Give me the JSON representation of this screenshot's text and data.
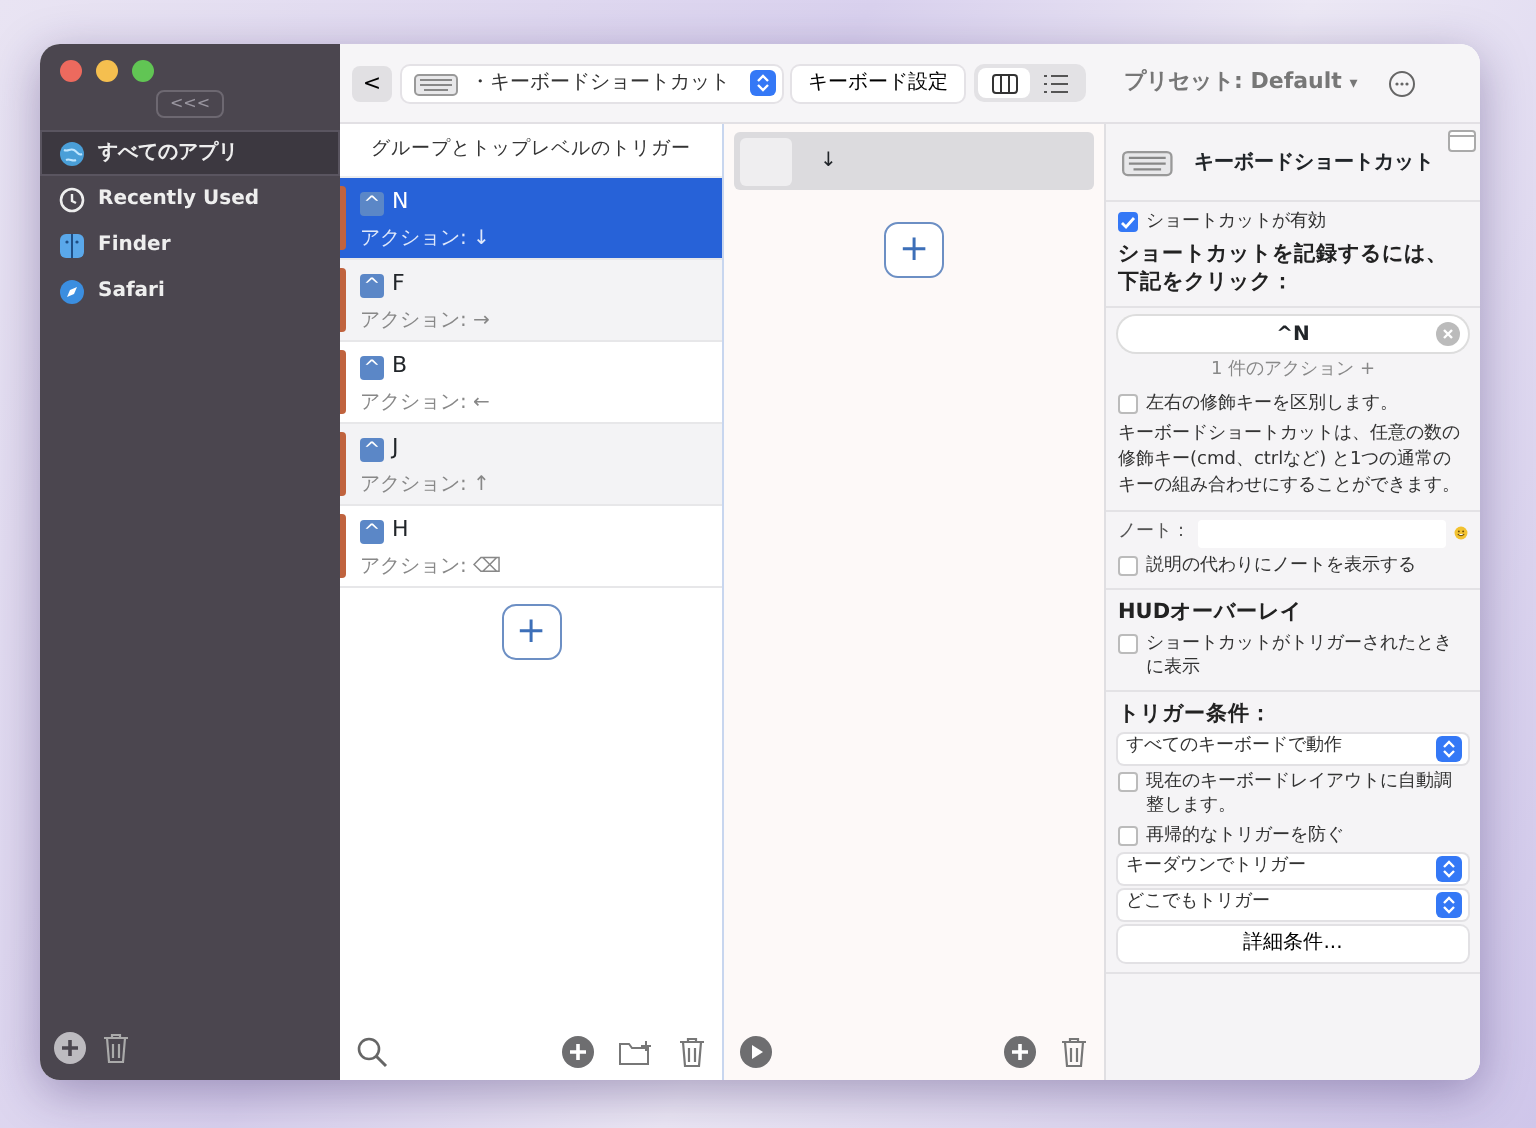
{
  "window": {
    "collapse_button": "<<<"
  },
  "sidebar": {
    "items": [
      {
        "label": "すべてのアプリ",
        "kind": "globe",
        "selected": true
      },
      {
        "label": "Recently Used",
        "kind": "clock",
        "selected": false
      },
      {
        "label": "Finder",
        "kind": "finder",
        "selected": false
      },
      {
        "label": "Safari",
        "kind": "compass",
        "selected": false
      }
    ]
  },
  "toolbar": {
    "back": "<",
    "trigger_type": "・キーボードショートカット",
    "settings_button": "キーボード設定",
    "views": [
      {
        "kind": "columns",
        "selected": true
      },
      {
        "kind": "list",
        "selected": false
      }
    ],
    "preset": "プリセット: Default",
    "preset_caret": "▾"
  },
  "triggers": {
    "header": "グループとトップレベルのトリガー",
    "items": [
      {
        "modifier": "^",
        "key": "N",
        "action": "アクション: ↓",
        "selected": true
      },
      {
        "modifier": "^",
        "key": "F",
        "action": "アクション: →",
        "selected": false
      },
      {
        "modifier": "^",
        "key": "B",
        "action": "アクション: ←",
        "selected": false
      },
      {
        "modifier": "^",
        "key": "J",
        "action": "アクション: ↑",
        "selected": false
      },
      {
        "modifier": "^",
        "key": "H",
        "action": "アクション: ⌫",
        "selected": false
      }
    ],
    "add_button": "+"
  },
  "actions": {
    "items": [
      {
        "label": "↓"
      }
    ],
    "add_button": "+"
  },
  "inspector": {
    "title": "キーボードショートカット",
    "sections": [
      [
        {
          "kind": "checkbox",
          "label": "ショートカットが有効",
          "checked": true
        },
        {
          "kind": "heading",
          "label": "ショートカットを記録するには、下記をクリック："
        }
      ],
      [
        {
          "kind": "shortcut",
          "value": "^N"
        },
        {
          "kind": "caption",
          "label": "1 件のアクション +"
        },
        {
          "kind": "checkbox",
          "label": "左右の修飾キーを区別します。",
          "checked": false
        },
        {
          "kind": "text",
          "label": "キーボードショートカットは、任意の数の修飾キー(cmd、ctrlなど) と1つの通常のキーの組み合わせにすることができます。"
        }
      ],
      [
        {
          "kind": "note",
          "label": "ノート："
        },
        {
          "kind": "checkbox",
          "label": "説明の代わりにノートを表示する",
          "checked": false
        }
      ],
      [
        {
          "kind": "heading",
          "label": "HUDオーバーレイ"
        },
        {
          "kind": "checkbox",
          "label": "ショートカットがトリガーされたときに表示",
          "checked": false
        }
      ],
      [
        {
          "kind": "heading",
          "label": "トリガー条件："
        },
        {
          "kind": "select",
          "label": "すべてのキーボードで動作"
        },
        {
          "kind": "checkbox",
          "label": "現在のキーボードレイアウトに自動調整します。",
          "checked": false
        },
        {
          "kind": "checkbox",
          "label": "再帰的なトリガーを防ぐ",
          "checked": false
        },
        {
          "kind": "select",
          "label": "キーダウンでトリガー"
        },
        {
          "kind": "select",
          "label": "どこでもトリガー"
        },
        {
          "kind": "button",
          "label": "詳細条件..."
        }
      ]
    ]
  }
}
